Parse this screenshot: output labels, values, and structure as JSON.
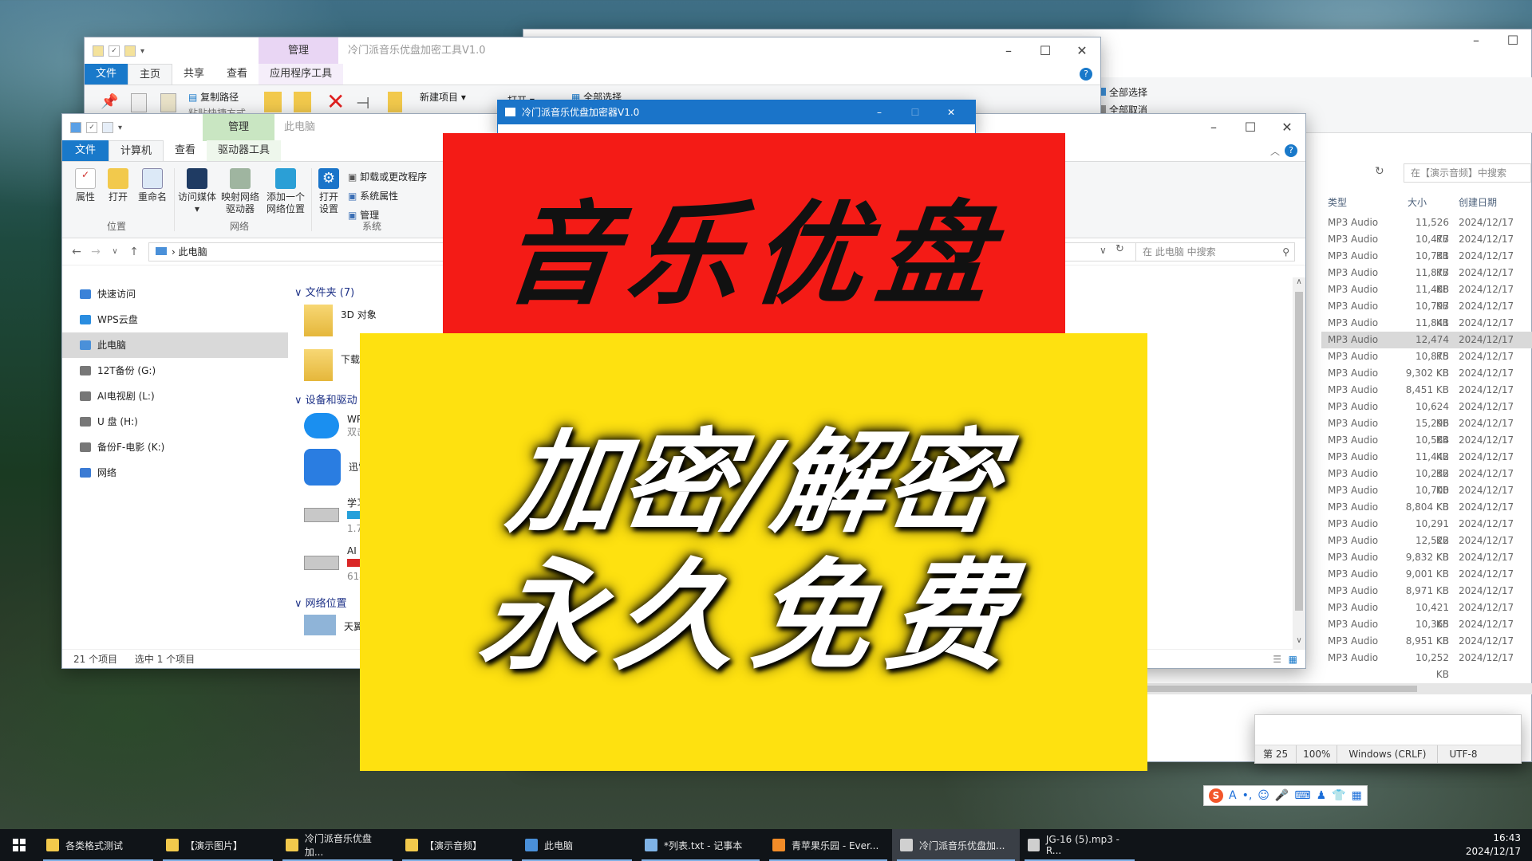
{
  "back_window": {
    "title": "冷门派音乐优盘加密工具V1.0",
    "context_tab": "管理",
    "tabs": [
      "文件",
      "主页",
      "共享",
      "查看",
      "应用程序工具"
    ],
    "ribbon_items": [
      "复制路径",
      "粘贴快捷方式",
      "新建项目",
      "打开",
      "全部选择"
    ]
  },
  "right_window": {
    "select_all": "全部选择",
    "deselect_all": "全部取消",
    "search_placeholder": "在【演示音频】中搜索",
    "col_type": "类型",
    "col_size": "大小",
    "col_date": "创建日期",
    "rows": [
      {
        "type": "MP3 Audio",
        "size": "11,526 KB",
        "date": "2024/12/17"
      },
      {
        "type": "MP3 Audio",
        "size": "10,477 KB",
        "date": "2024/12/17"
      },
      {
        "type": "MP3 Audio",
        "size": "10,731 KB",
        "date": "2024/12/17"
      },
      {
        "type": "MP3 Audio",
        "size": "11,877 KB",
        "date": "2024/12/17"
      },
      {
        "type": "MP3 Audio",
        "size": "11,488 KB",
        "date": "2024/12/17"
      },
      {
        "type": "MP3 Audio",
        "size": "10,797 KB",
        "date": "2024/12/17"
      },
      {
        "type": "MP3 Audio",
        "size": "11,841 KB",
        "date": "2024/12/17"
      },
      {
        "type": "MP3 Audio",
        "size": "12,474 KB",
        "date": "2024/12/17"
      },
      {
        "type": "MP3 Audio",
        "size": "10,875 KB",
        "date": "2024/12/17"
      },
      {
        "type": "MP3 Audio",
        "size": "9,302 KB",
        "date": "2024/12/17"
      },
      {
        "type": "MP3 Audio",
        "size": "8,451 KB",
        "date": "2024/12/17"
      },
      {
        "type": "MP3 Audio",
        "size": "10,624 KB",
        "date": "2024/12/17"
      },
      {
        "type": "MP3 Audio",
        "size": "15,296 KB",
        "date": "2024/12/17"
      },
      {
        "type": "MP3 Audio",
        "size": "10,584 KB",
        "date": "2024/12/17"
      },
      {
        "type": "MP3 Audio",
        "size": "11,442 KB",
        "date": "2024/12/17"
      },
      {
        "type": "MP3 Audio",
        "size": "10,232 KB",
        "date": "2024/12/17"
      },
      {
        "type": "MP3 Audio",
        "size": "10,700 KB",
        "date": "2024/12/17"
      },
      {
        "type": "MP3 Audio",
        "size": "8,804 KB",
        "date": "2024/12/17"
      },
      {
        "type": "MP3 Audio",
        "size": "10,291 KB",
        "date": "2024/12/17"
      },
      {
        "type": "MP3 Audio",
        "size": "12,522 KB",
        "date": "2024/12/17"
      },
      {
        "type": "MP3 Audio",
        "size": "9,832 KB",
        "date": "2024/12/17"
      },
      {
        "type": "MP3 Audio",
        "size": "9,001 KB",
        "date": "2024/12/17"
      },
      {
        "type": "MP3 Audio",
        "size": "8,971 KB",
        "date": "2024/12/17"
      },
      {
        "type": "MP3 Audio",
        "size": "10,421 KB",
        "date": "2024/12/17"
      },
      {
        "type": "MP3 Audio",
        "size": "10,365 KB",
        "date": "2024/12/17"
      },
      {
        "type": "MP3 Audio",
        "size": "8,951 KB",
        "date": "2024/12/17"
      },
      {
        "type": "MP3 Audio",
        "size": "10,252 KB",
        "date": "2024/12/17"
      }
    ],
    "selected_row_index": 7
  },
  "explorer": {
    "context_tab": "管理",
    "title": "此电脑",
    "tabs": [
      "文件",
      "计算机",
      "查看",
      "驱动器工具"
    ],
    "ribbon": {
      "properties": "属性",
      "open": "打开",
      "rename": "重命名",
      "access_media": "访问媒体",
      "map_drive": "映射网络\n驱动器",
      "add_location": "添加一个\n网络位置",
      "open_settings": "打开\n设置",
      "uninstall": "卸载或更改程序",
      "system_properties": "系统属性",
      "manage": "管理",
      "group_location": "位置",
      "group_network": "网络",
      "group_system": "系统"
    },
    "address": "此电脑",
    "search_placeholder": "在 此电脑 中搜索",
    "nav": [
      {
        "label": "快速访问",
        "color": "#3b82d8"
      },
      {
        "label": "WPS云盘",
        "color": "#2a8de0"
      },
      {
        "label": "此电脑",
        "color": "#4a90d9"
      },
      {
        "label": "12T备份 (G:)",
        "color": "#777777"
      },
      {
        "label": "AI电视剧 (L:)",
        "color": "#777777"
      },
      {
        "label": "U 盘 (H:)",
        "color": "#777777"
      },
      {
        "label": "备份F-电影 (K:)",
        "color": "#777777"
      },
      {
        "label": "网络",
        "color": "#3b7bd4"
      }
    ],
    "nav_selected_index": 2,
    "sections": {
      "folders": "文件夹 (7)",
      "devices": "设备和驱动",
      "network_locations": "网络位置"
    },
    "items": {
      "objects_3d": "3D 对象",
      "downloads": "下载",
      "wps": "WP",
      "wps_sub": "双击",
      "xunlei": "迅雷",
      "study": "学习",
      "study_sub": "1.7",
      "ai": "AI",
      "ai_sub": "614",
      "tianyi": "天翼"
    },
    "status_items": "21 个项目",
    "status_selected": "选中 1 个项目"
  },
  "dialog": {
    "title": "冷门派音乐优盘加密器V1.0"
  },
  "banner": {
    "red_text": "音乐优盘",
    "yellow_line1": "加密/解密",
    "yellow_line2": "永久免费"
  },
  "notepad_status": {
    "line": "第 25",
    "zoom": "100%",
    "eol": "Windows (CRLF)",
    "encoding": "UTF-8"
  },
  "ime_bar": {
    "logo": "S",
    "mode": "A"
  },
  "taskbar": {
    "items": [
      {
        "label": "各类格式测试",
        "color": "#f2c94c"
      },
      {
        "label": "【演示图片】",
        "color": "#f2c94c"
      },
      {
        "label": "冷门派音乐优盘加...",
        "color": "#f2c94c"
      },
      {
        "label": "【演示音频】",
        "color": "#f2c94c"
      },
      {
        "label": "此电脑",
        "color": "#4a90d9"
      },
      {
        "label": "*列表.txt - 记事本",
        "color": "#7fb3e6"
      },
      {
        "label": "青苹果乐园 - Ever...",
        "color": "#f28c28"
      },
      {
        "label": "冷门派音乐优盘加...",
        "color": "#d0d0d0"
      },
      {
        "label": "JG-16 (5).mp3 - R...",
        "color": "#cfcfcf"
      }
    ],
    "time": "16:43",
    "date": "2024/12/17"
  }
}
